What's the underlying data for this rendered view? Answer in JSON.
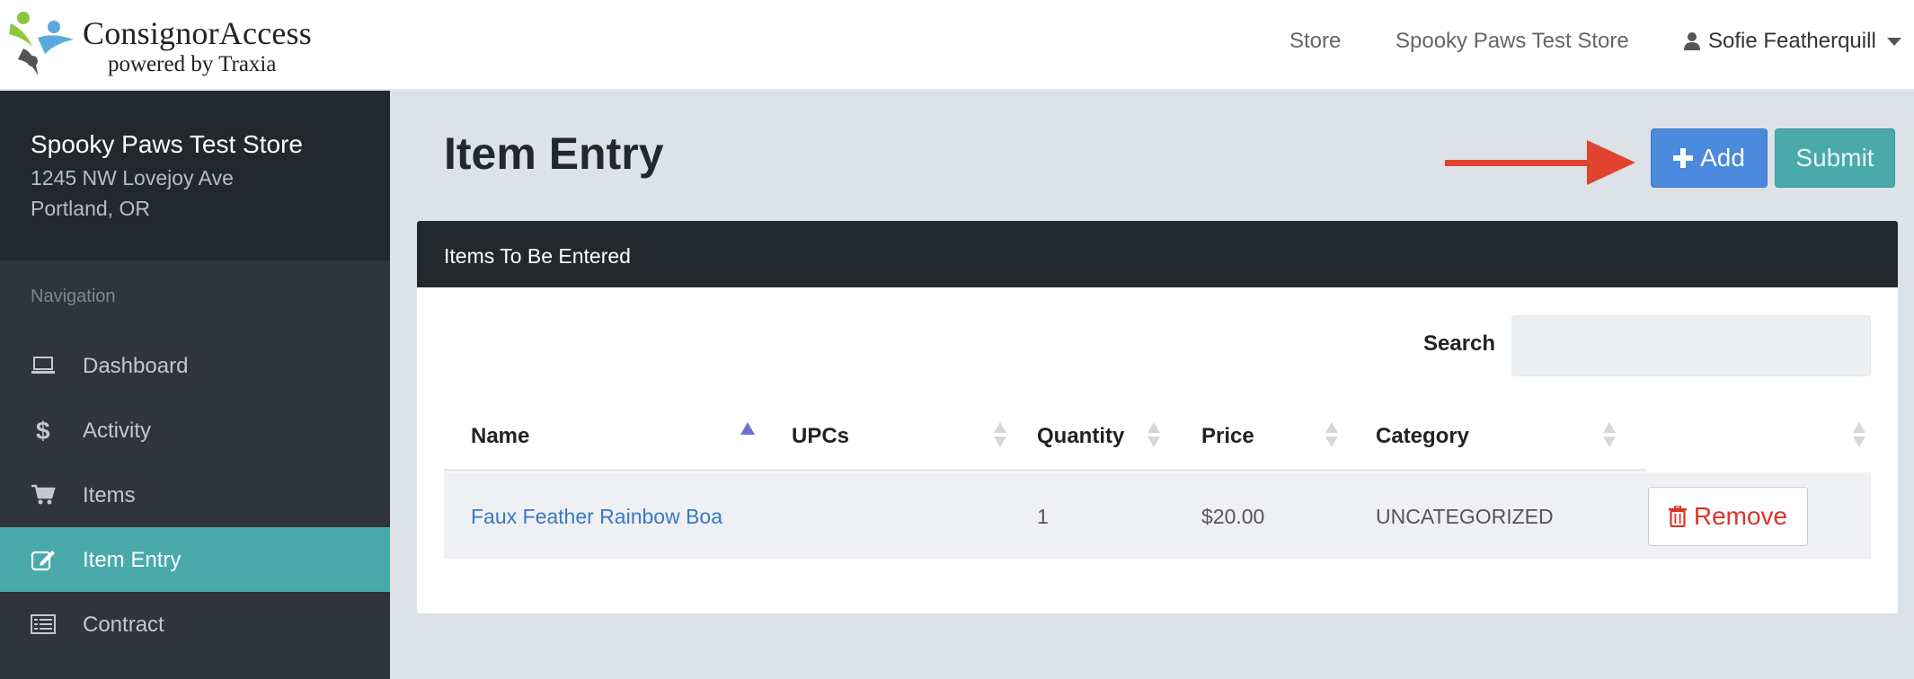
{
  "header": {
    "logo": {
      "title": "ConsignorAccess",
      "subtitle": "powered by Traxia"
    },
    "nav": {
      "store": "Store",
      "store_name": "Spooky Paws Test Store",
      "user": "Sofie Featherquill"
    }
  },
  "sidebar": {
    "store": {
      "name": "Spooky Paws Test Store",
      "address_line1": "1245 NW Lovejoy Ave",
      "address_line2": "Portland, OR"
    },
    "heading": "Navigation",
    "items": [
      {
        "label": "Dashboard",
        "icon": "laptop-icon",
        "active": false
      },
      {
        "label": "Activity",
        "icon": "dollar-icon",
        "active": false
      },
      {
        "label": "Items",
        "icon": "cart-icon",
        "active": false
      },
      {
        "label": "Item Entry",
        "icon": "edit-icon",
        "active": true
      },
      {
        "label": "Contract",
        "icon": "list-icon",
        "active": false
      }
    ]
  },
  "main": {
    "title": "Item Entry",
    "add_label": "Add",
    "submit_label": "Submit",
    "panel": {
      "title": "Items To Be Entered",
      "search_label": "Search",
      "search_value": "",
      "columns": [
        "Name",
        "UPCs",
        "Quantity",
        "Price",
        "Category"
      ],
      "sorted_column": "Name",
      "rows": [
        {
          "name": "Faux Feather Rainbow Boa",
          "upcs": "",
          "quantity": "1",
          "price": "$20.00",
          "category": "UNCATEGORIZED",
          "action": "Remove"
        }
      ]
    }
  },
  "colors": {
    "sidebar_bg": "#2f353b",
    "active_teal": "#4aa9aa",
    "add_blue": "#4a89dc",
    "annotation_arrow": "#e0432f",
    "remove_red": "#d9342b",
    "link_blue": "#3a78c3"
  }
}
